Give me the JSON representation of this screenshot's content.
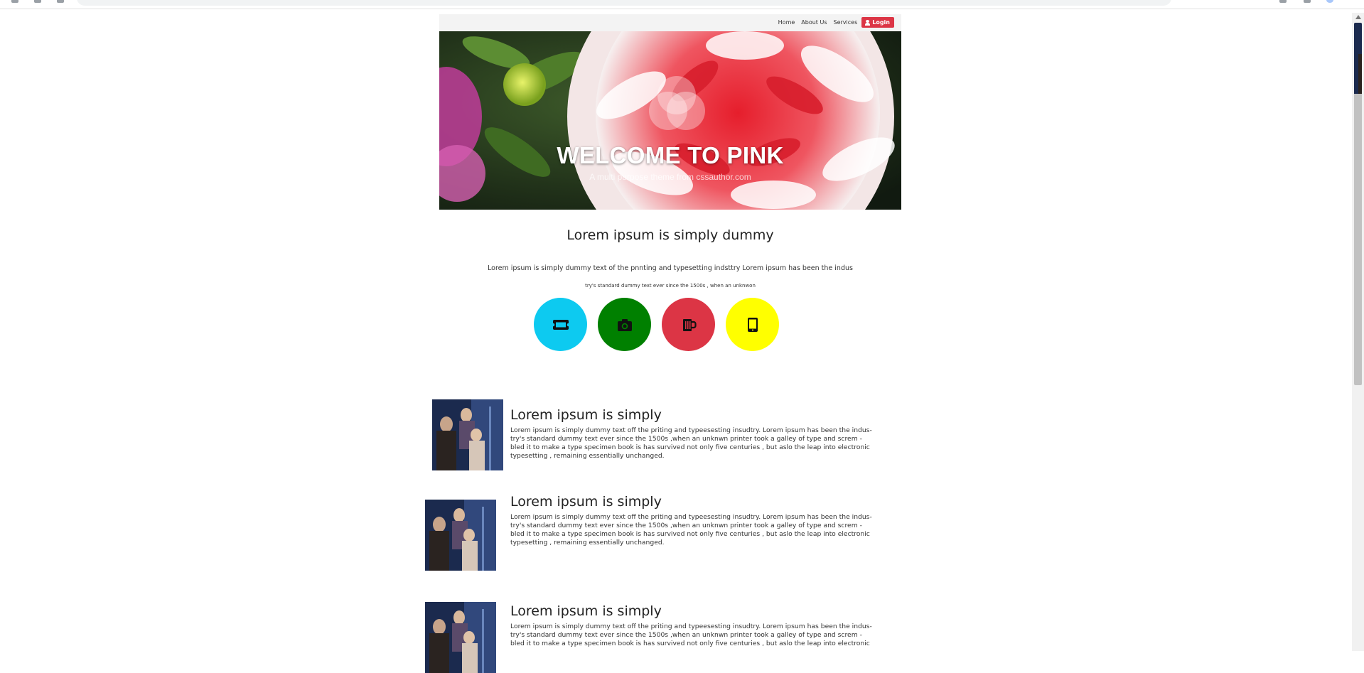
{
  "nav": {
    "links": [
      "Home",
      "About Us",
      "Services"
    ],
    "login_label": "Login",
    "login_color": "#dc3545"
  },
  "hero": {
    "title": "WELCOME TO PINK",
    "subtitle": "A multi purpose theme from cssauthor.com"
  },
  "section": {
    "heading": "Lorem ipsum is simply dummy",
    "intro_line1": "Lorem ipsum is simply dummy text of the pnnting and typesetting indsttry Lorem ipsum has been the indus",
    "intro_line2": "try's standard dummy text ever since the 1500s , when an unknwon"
  },
  "feature_circles": [
    {
      "icon": "ticket-icon",
      "color": "#0dcaf0"
    },
    {
      "icon": "camera-icon",
      "color": "#008000"
    },
    {
      "icon": "mug-icon",
      "color": "#dc3545"
    },
    {
      "icon": "tablet-icon",
      "color": "#ffff00"
    }
  ],
  "articles": [
    {
      "title": "Lorem ipsum is simply",
      "body_lines": [
        "Lorem ipsum is simply dummy text off the priting and typeesesting insudtry. Lorem ipsum has been the indus-",
        "try's standard dummy text ever since the 1500s ,when an unknwn printer took a galley of type and screm -",
        "bled it to make a type specimen book is has survived not only five centuries , but aslo the leap into electronic",
        "typesetting , remaining essentially unchanged."
      ]
    },
    {
      "title": "Lorem ipsum is simply",
      "body_lines": [
        "Lorem ipsum is simply dummy text off the priting and typeesesting insudtry. Lorem ipsum has been the indus-",
        "try's standard dummy text ever since the 1500s ,when an unknwn printer took a galley of type and screm -",
        "bled it to make a type specimen book is has survived not only five centuries , but aslo the leap into electronic",
        "typesetting , remaining essentially unchanged."
      ]
    },
    {
      "title": "Lorem ipsum is simply",
      "body_lines": [
        "Lorem ipsum is simply dummy text off the priting and typeesesting insudtry. Lorem ipsum has been the indus-",
        "try's standard dummy text ever since the 1500s ,when an unknwn printer took a galley of type and screm -",
        "bled it to make a type specimen book is has survived not only five centuries , but aslo the leap into electronic"
      ]
    }
  ]
}
